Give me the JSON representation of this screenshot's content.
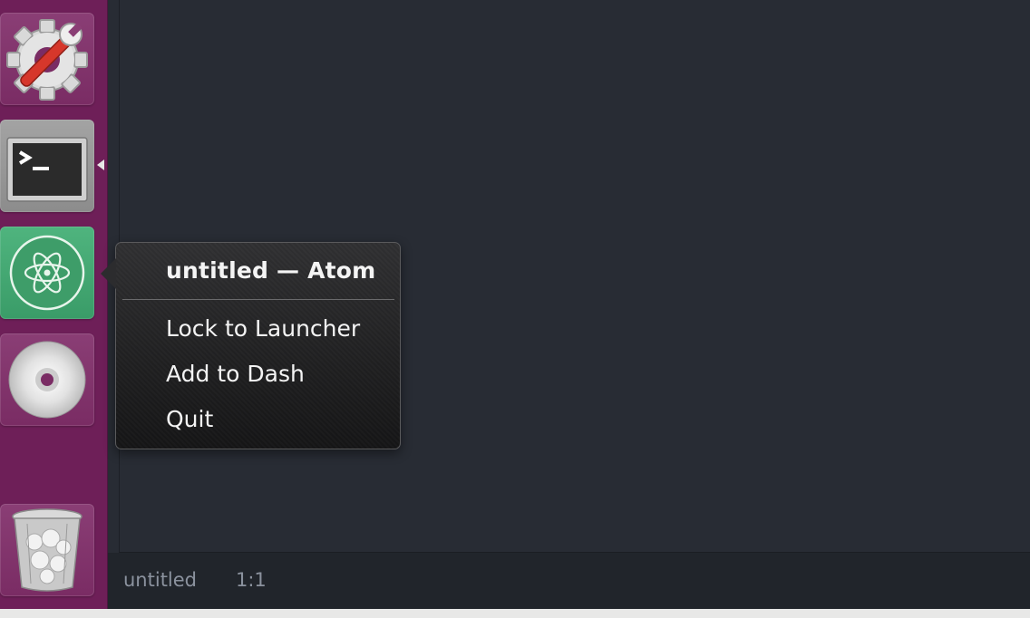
{
  "launcher": {
    "items": [
      {
        "name": "System Settings",
        "icon": "settings-gear-wrench-icon"
      },
      {
        "name": "Terminal",
        "icon": "terminal-icon",
        "running": true
      },
      {
        "name": "Atom",
        "icon": "atom-icon",
        "running": true
      },
      {
        "name": "Disc",
        "icon": "disc-icon"
      },
      {
        "name": "Trash",
        "icon": "trash-icon"
      }
    ]
  },
  "quicklist": {
    "title": "untitled — Atom",
    "items": [
      "Lock to Launcher",
      "Add to Dash",
      "Quit"
    ]
  },
  "status_bar": {
    "file": "untitled",
    "cursor_position": "1:1"
  },
  "colors": {
    "launcher_bg": "#6e1f58",
    "editor_bg": "#282c34",
    "status_bg": "#21252b",
    "atom_tile": "#3a9c68"
  }
}
